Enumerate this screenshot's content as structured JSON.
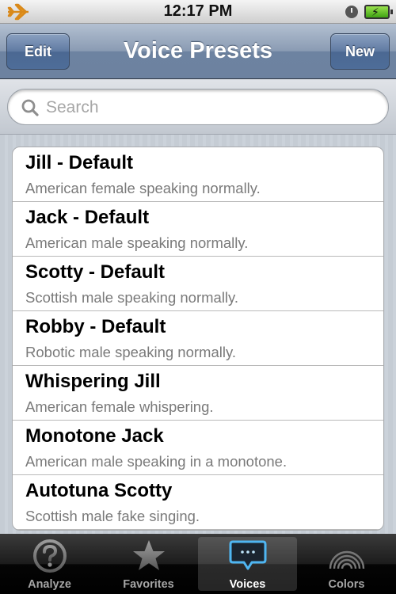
{
  "status_bar": {
    "time": "12:17 PM"
  },
  "nav": {
    "title": "Voice Presets",
    "edit_label": "Edit",
    "new_label": "New"
  },
  "search": {
    "placeholder": "Search",
    "value": ""
  },
  "presets": [
    {
      "name": "Jill - Default",
      "description": "American female speaking normally."
    },
    {
      "name": "Jack - Default",
      "description": "American male speaking normally."
    },
    {
      "name": "Scotty - Default",
      "description": "Scottish male speaking normally."
    },
    {
      "name": "Robby - Default",
      "description": "Robotic male speaking normally."
    },
    {
      "name": "Whispering Jill",
      "description": "American female whispering."
    },
    {
      "name": "Monotone Jack",
      "description": "American male speaking in a monotone."
    },
    {
      "name": "Autotuna Scotty",
      "description": "Scottish male fake singing."
    }
  ],
  "tabs": [
    {
      "label": "Analyze",
      "icon": "question-icon",
      "selected": false
    },
    {
      "label": "Favorites",
      "icon": "star-icon",
      "selected": false
    },
    {
      "label": "Voices",
      "icon": "speech-bubble-icon",
      "selected": true
    },
    {
      "label": "Colors",
      "icon": "rainbow-icon",
      "selected": false
    }
  ],
  "colors": {
    "accent": "#6d83a1",
    "airplane": "#f0a020",
    "battery": "#5cc52a"
  }
}
